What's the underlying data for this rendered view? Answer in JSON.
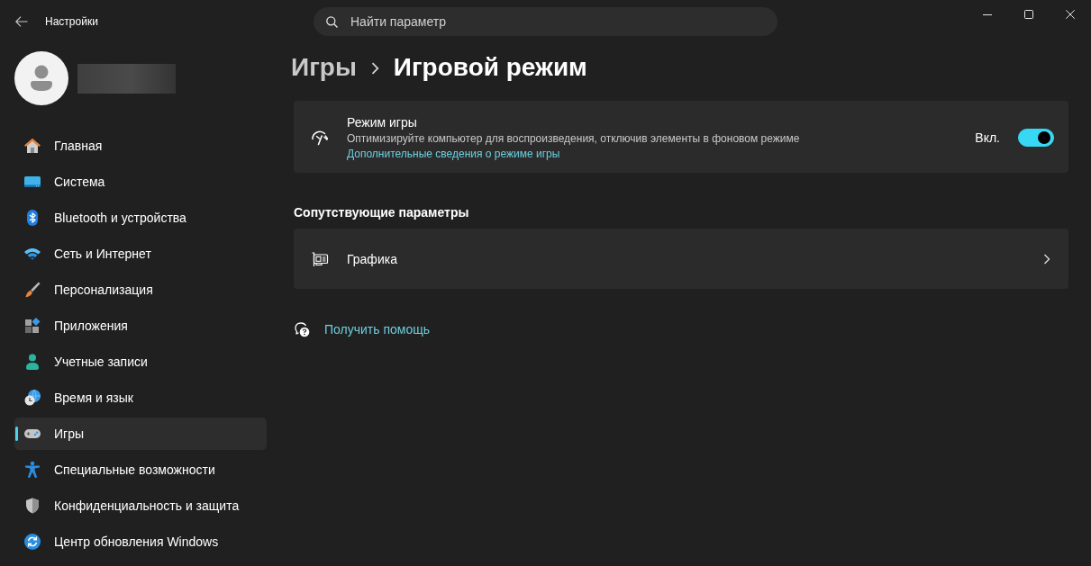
{
  "window": {
    "title": "Настройки"
  },
  "search": {
    "placeholder": "Найти параметр"
  },
  "sidebar": {
    "items": [
      {
        "label": "Главная",
        "selected": false
      },
      {
        "label": "Система",
        "selected": false
      },
      {
        "label": "Bluetooth и устройства",
        "selected": false
      },
      {
        "label": "Сеть и Интернет",
        "selected": false
      },
      {
        "label": "Персонализация",
        "selected": false
      },
      {
        "label": "Приложения",
        "selected": false
      },
      {
        "label": "Учетные записи",
        "selected": false
      },
      {
        "label": "Время и язык",
        "selected": false
      },
      {
        "label": "Игры",
        "selected": true
      },
      {
        "label": "Специальные возможности",
        "selected": false
      },
      {
        "label": "Конфиденциальность и защита",
        "selected": false
      },
      {
        "label": "Центр обновления Windows",
        "selected": false
      }
    ]
  },
  "breadcrumb": [
    {
      "label": "Игры",
      "current": false
    },
    {
      "label": "Игровой режим",
      "current": true
    }
  ],
  "game_mode": {
    "title": "Режим игры",
    "description": "Оптимизируйте компьютер для воспроизведения, отключив элементы в фоновом режиме",
    "link": "Дополнительные сведения о режиме игры",
    "toggle": {
      "label": "Вкл.",
      "on": true
    }
  },
  "related": {
    "heading": "Сопутствующие параметры",
    "items": [
      {
        "label": "Графика"
      }
    ]
  },
  "help": {
    "label": "Получить помощь"
  }
}
